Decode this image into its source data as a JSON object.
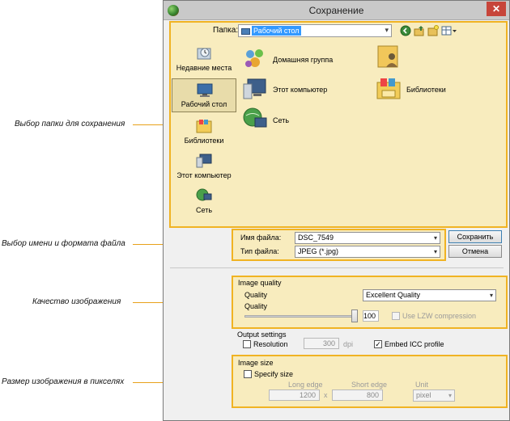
{
  "annotations": {
    "folder": "Выбор папки для сохранения",
    "filename": "Выбор имени и формата файла",
    "quality": "Качество изображения",
    "size": "Размер изображения в пикселях"
  },
  "window": {
    "title": "Сохранение",
    "close_glyph": "✕"
  },
  "toolbar": {
    "folder_label": "Папка:",
    "folder_value": "Рабочий стол",
    "icons": [
      "back-icon",
      "up-folder-icon",
      "new-folder-icon",
      "view-menu-icon"
    ]
  },
  "places": [
    {
      "label": "Недавние места",
      "icon": "recent-places-icon",
      "selected": false
    },
    {
      "label": "Рабочий стол",
      "icon": "desktop-icon",
      "selected": true
    },
    {
      "label": "Библиотеки",
      "icon": "libraries-icon",
      "selected": false
    },
    {
      "label": "Этот компьютер",
      "icon": "computer-icon",
      "selected": false
    },
    {
      "label": "Сеть",
      "icon": "network-icon",
      "selected": false
    }
  ],
  "files": [
    {
      "label": "Домашняя группа",
      "icon": "homegroup-icon"
    },
    {
      "label": "",
      "icon": "user-folder-icon"
    },
    {
      "label": "Этот компьютер",
      "icon": "computer-icon"
    },
    {
      "label": "Библиотеки",
      "icon": "libraries-icon"
    },
    {
      "label": "Сеть",
      "icon": "network-icon"
    }
  ],
  "file_name": {
    "label": "Имя файла:",
    "value": "DSC_7549"
  },
  "file_type": {
    "label": "Тип файла:",
    "value": "JPEG (*.jpg)"
  },
  "buttons": {
    "save": "Сохранить",
    "cancel": "Отмена"
  },
  "image_quality": {
    "group_label": "Image quality",
    "quality_label": "Quality",
    "preset": "Excellent Quality",
    "slider_label": "Quality",
    "slider_value": "100",
    "slider_fraction": 1.0,
    "lzw_label": "Use LZW compression",
    "lzw_checked": false
  },
  "output_settings": {
    "group_label": "Output settings",
    "resolution_label": "Resolution",
    "resolution_checked": false,
    "resolution_value": "300",
    "resolution_unit": "dpi",
    "icc_label": "Embed ICC profile",
    "icc_checked": true
  },
  "image_size": {
    "group_label": "Image size",
    "specify_label": "Specify size",
    "specify_checked": false,
    "long_edge_label": "Long edge",
    "short_edge_label": "Short edge",
    "unit_label": "Unit",
    "long_edge_value": "1200",
    "times_glyph": "x",
    "short_edge_value": "800",
    "unit_value": "pixel"
  },
  "colors": {
    "highlight_border": "#f0b323",
    "highlight_fill": "#fff1b8",
    "accent_line": "#e8a11a",
    "selection_blue": "#3399ff"
  }
}
